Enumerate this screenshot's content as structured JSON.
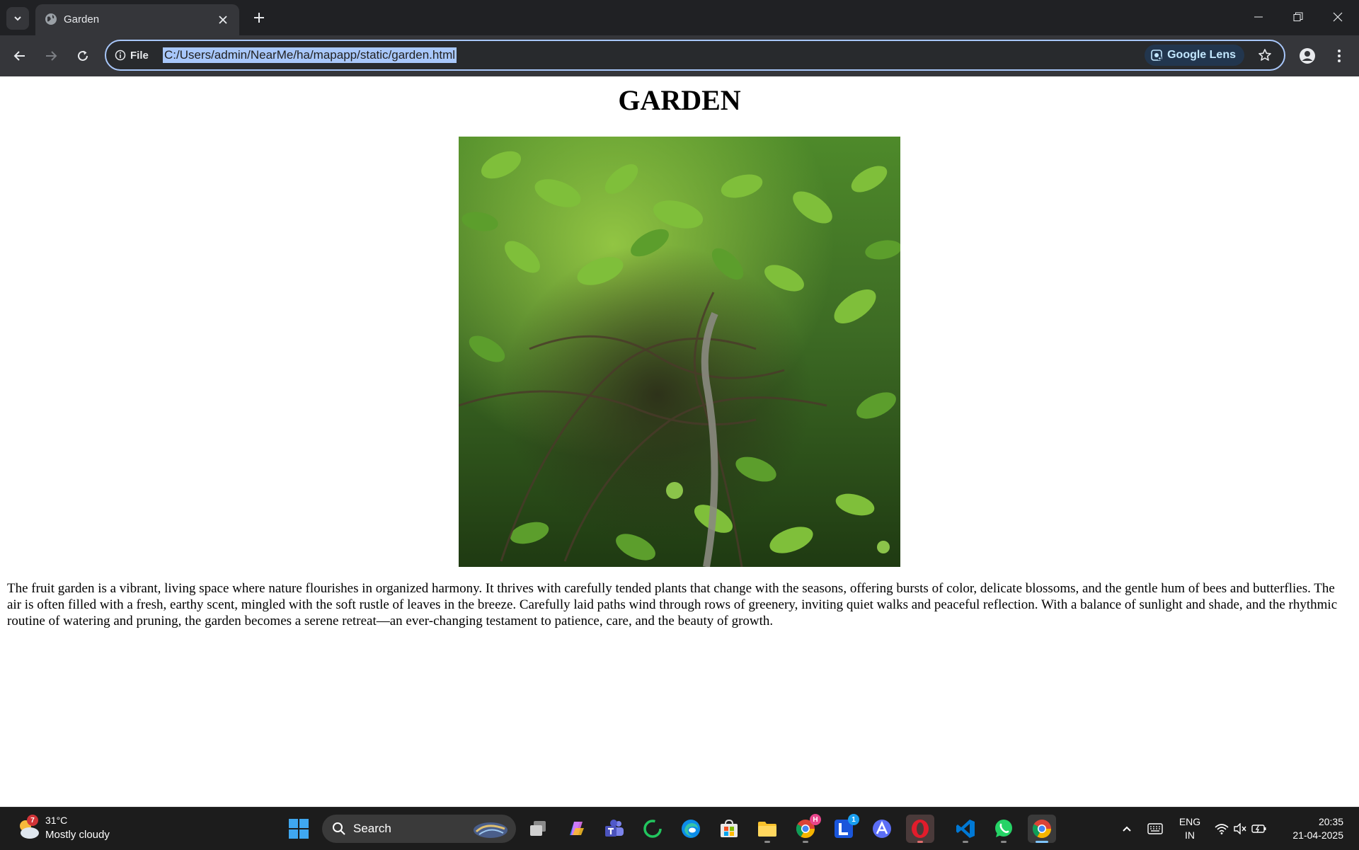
{
  "browser": {
    "tab": {
      "title": "Garden"
    },
    "address_bar": {
      "site_info_label": "File",
      "url": "C:/Users/admin/NearMe/ha/mapapp/static/garden.html"
    },
    "lens_label": "Google Lens"
  },
  "page": {
    "heading": "GARDEN",
    "image_alt": "garden photo",
    "paragraph": "The fruit garden is a vibrant, living space where nature flourishes in organized harmony. It thrives with carefully tended plants that change with the seasons, offering bursts of color, delicate blossoms, and the gentle hum of bees and butterflies. The air is often filled with a fresh, earthy scent, mingled with the soft rustle of leaves in the breeze. Carefully laid paths wind through rows of greenery, inviting quiet walks and peaceful reflection. With a balance of sunlight and shade, and the rhythmic routine of watering and pruning, the garden becomes a serene retreat—an ever-changing testament to patience, care, and the beauty of growth."
  },
  "taskbar": {
    "weather": {
      "badge": "7",
      "temp": "31°C",
      "desc": "Mostly cloudy"
    },
    "search_label": "Search",
    "badges": {
      "chrome_profile": "H",
      "l_app": "1"
    },
    "tray": {
      "lang_line1": "ENG",
      "lang_line2": "IN",
      "time": "20:35",
      "date": "21-04-2025"
    }
  },
  "colors": {
    "tab_strip": "#202124",
    "toolbar": "#35363a",
    "url_highlight": "#a8c7fa",
    "taskbar": "#1c1c1c"
  }
}
